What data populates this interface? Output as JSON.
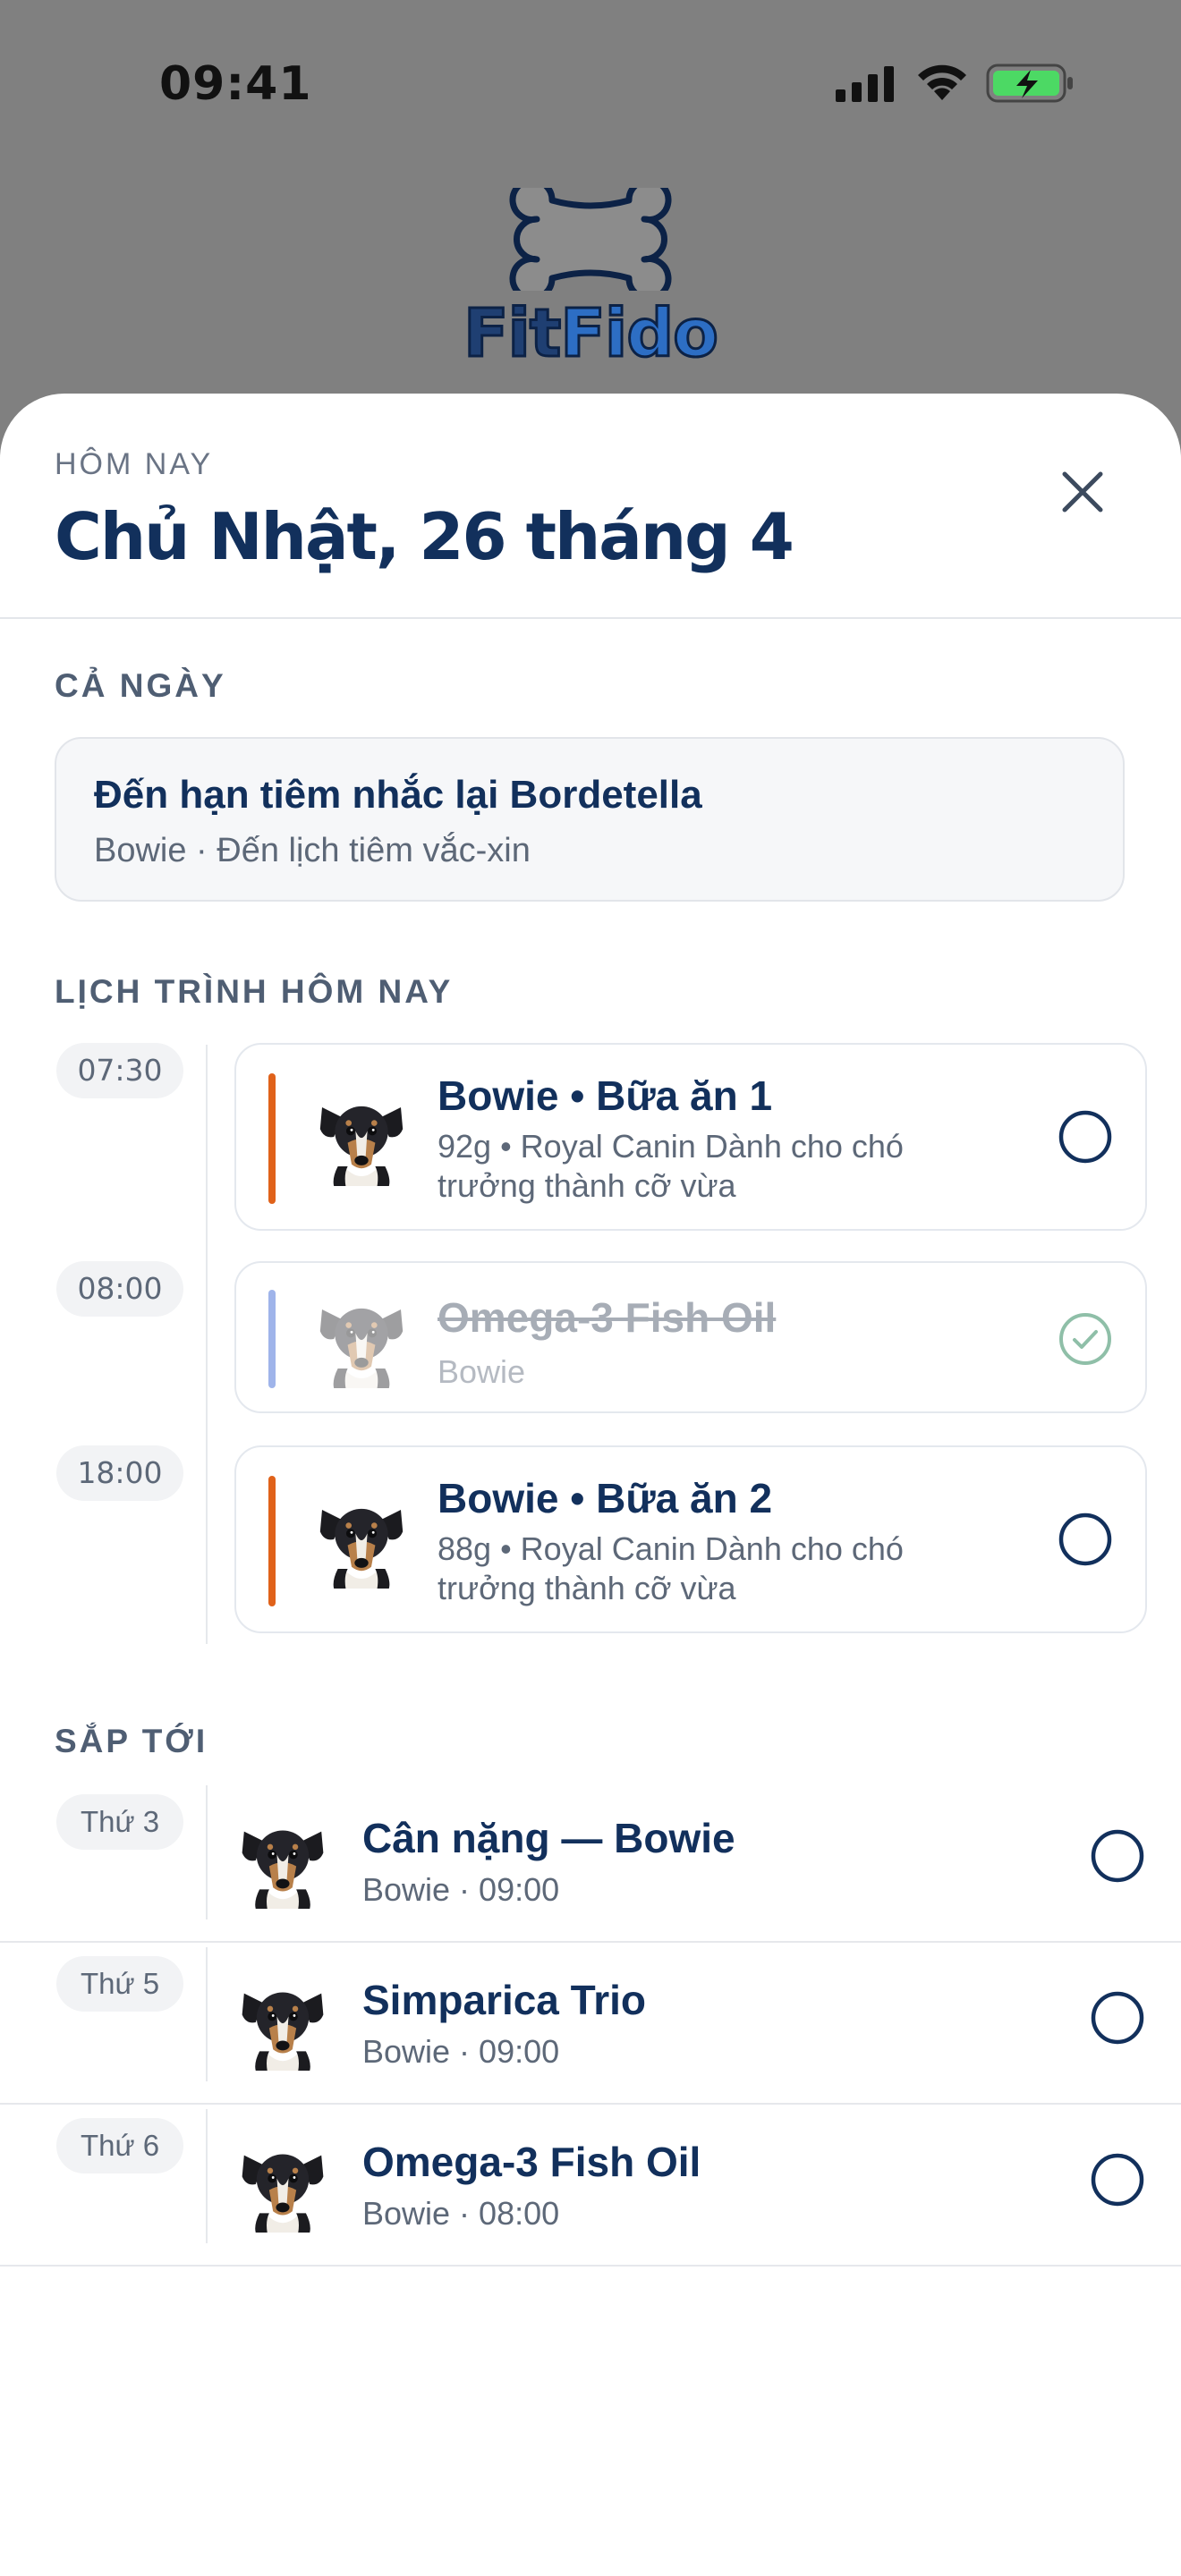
{
  "status_bar": {
    "time": "09:41"
  },
  "brand": {
    "name_part1": "Fit",
    "name_part2": "Fido",
    "logo_icon": "bone-icon"
  },
  "sheet": {
    "eyebrow": "HÔM NAY",
    "title": "Chủ Nhật, 26 tháng 4",
    "close_icon": "close-icon"
  },
  "all_day": {
    "section_label": "CẢ NGÀY",
    "title": "Đến hạn tiêm nhắc lại Bordetella",
    "subtitle": "Bowie · Đến lịch tiêm vắc-xin"
  },
  "schedule": {
    "section_label": "LỊCH TRÌNH HÔM NAY",
    "items": [
      {
        "time": "07:30",
        "title": "Bowie • Bữa ăn 1",
        "subtitle_line1": "92g • Royal Canin Dành cho chó",
        "subtitle_line2": "trưởng thành cỡ vừa",
        "accent_color": "#e0621a",
        "done": false
      },
      {
        "time": "08:00",
        "title": "Omega-3 Fish Oil",
        "subtitle_line1": "Bowie",
        "subtitle_line2": "",
        "accent_color": "#9fb4ea",
        "done": true
      },
      {
        "time": "18:00",
        "title": "Bowie • Bữa ăn 2",
        "subtitle_line1": "88g • Royal Canin Dành cho chó",
        "subtitle_line2": "trưởng thành cỡ vừa",
        "accent_color": "#e0621a",
        "done": false
      }
    ]
  },
  "upcoming": {
    "section_label": "SẮP TỚI",
    "items": [
      {
        "day": "Thứ 3",
        "title": "Cân nặng — Bowie",
        "subtitle": "Bowie · 09:00"
      },
      {
        "day": "Thứ 5",
        "title": "Simparica Trio",
        "subtitle": "Bowie · 09:00"
      },
      {
        "day": "Thứ 6",
        "title": "Omega-3 Fish Oil",
        "subtitle": "Bowie · 08:00"
      }
    ]
  },
  "colors": {
    "navy": "#12305c",
    "meal_accent": "#e0621a",
    "supplement_accent": "#9fb4ea",
    "done_check": "#8fbfa8",
    "battery_green": "#4cd964"
  }
}
